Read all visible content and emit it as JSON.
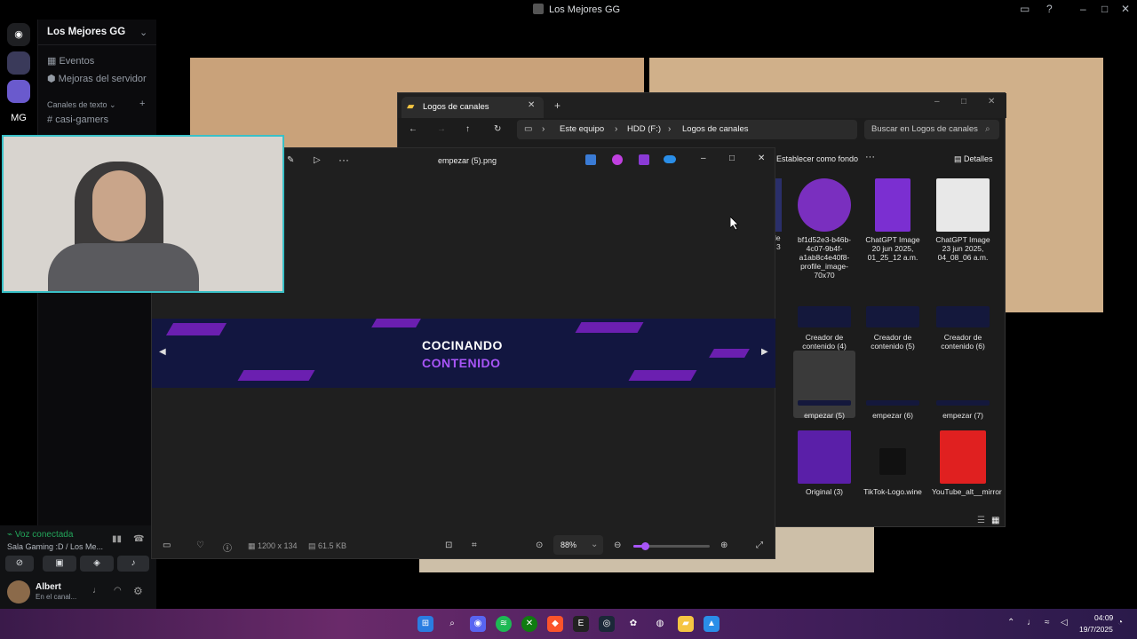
{
  "window": {
    "title": "Los Mejores GG"
  },
  "discord": {
    "server_name": "Los Mejores GG",
    "server_initials": "MG",
    "events_label": "Eventos",
    "boosts_label": "Mejoras del servidor",
    "text_channels_label": "Canales de texto",
    "channel_name": "casi-gamers",
    "voice_status": "Voz conectada",
    "voice_channel": "Sala Gaming :D / Los Me...",
    "user_name": "Albert",
    "user_status": "En el canal..."
  },
  "explorer": {
    "tab_title": "Logos de canales",
    "breadcrumb": [
      "Este equipo",
      "HDD (F:)",
      "Logos de canales"
    ],
    "search_placeholder": "Buscar en Logos de canales",
    "toolbar_set_bg": "Establecer como fondo",
    "toolbar_details": "Detalles",
    "files": [
      {
        "name": "bf1d52e3-b46b-4c07-9b4f-a1ab8c4e40f8-profile_image-70x70",
        "color": "#7a2fbf"
      },
      {
        "name": "ChatGPT Image 20 jun 2025, 01_25_12 a.m.",
        "color": "#7b2fd1"
      },
      {
        "name": "ChatGPT Image 23 jun 2025, 04_08_06 a.m.",
        "color": "#e8e8e8"
      },
      {
        "name": "Creador de contenido (4)",
        "color": "#14183c"
      },
      {
        "name": "Creador de contenido (5)",
        "color": "#14183c"
      },
      {
        "name": "Creador de contenido (6)",
        "color": "#14183c"
      },
      {
        "name": "empezar (5)",
        "color": "#14183c"
      },
      {
        "name": "empezar (6)",
        "color": "#14183c"
      },
      {
        "name": "empezar (7)",
        "color": "#14183c"
      },
      {
        "name": "Original (3)",
        "color": "#5a1fa8"
      },
      {
        "name": "TikTok-Logo.wine",
        "color": "#111111"
      },
      {
        "name": "YouTube_alt__mirror",
        "color": "#e02020"
      }
    ],
    "partial_labels": [
      "le",
      "3"
    ]
  },
  "viewer": {
    "file_name": "empezar (5).png",
    "banner_line1": "COCINANDO",
    "banner_line2": "CONTENIDO",
    "dimensions": "1200 x 134",
    "file_size": "61.5 KB",
    "zoom": "88%",
    "zoom_level": 0.15
  },
  "tray": {
    "time": "04:09",
    "date": "19/7/2025"
  },
  "colors": {
    "accent": "#39c0c7",
    "purple": "#a855f7",
    "banner_bg": "#121640"
  }
}
